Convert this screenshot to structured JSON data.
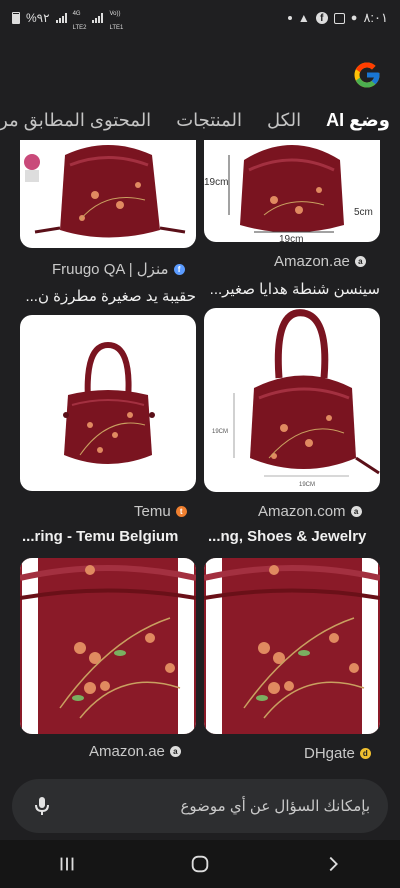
{
  "status_bar": {
    "battery": "%٩٢",
    "network_1": "4G",
    "network_1_sub": "LTE2",
    "network_2": "Vo))",
    "network_2_sub": "LTE1",
    "time": "٨:٠١"
  },
  "tabs": [
    {
      "label": "وضع AI",
      "active": true
    },
    {
      "label": "الكل",
      "active": false
    },
    {
      "label": "المنتجات",
      "active": false
    },
    {
      "label": "المحتوى المطابق مرئيًا",
      "active": false
    }
  ],
  "results": [
    {
      "source": "Amazon.ae",
      "caption": "سينسن شنطة هدايا صغير...",
      "favicon": "amazon-icon"
    },
    {
      "source": "Fruugo QA | منزل",
      "caption": "حقيبة يد صغيرة مطرزة ن...",
      "favicon": "fruugo-icon"
    },
    {
      "source": "Amazon.com",
      "caption": "...ng, Shoes & Jewelry",
      "favicon": "amazon-icon"
    },
    {
      "source": "Temu",
      "caption": "...ring - Temu Belgium",
      "favicon": "temu-icon"
    },
    {
      "source": "DHgate",
      "caption": "",
      "favicon": "dhgate-icon"
    },
    {
      "source": "Amazon.ae",
      "caption": "",
      "favicon": "amazon-icon"
    }
  ],
  "image_labels": {
    "height_1": "19cm",
    "width_1": "5cm",
    "bottom_1": "19cm",
    "height_2": "19CM",
    "bottom_2": "19CM"
  },
  "search": {
    "placeholder": "بإمكانك السؤال عن أي موضوع"
  },
  "colors": {
    "background": "#1f1f21",
    "bag": "#7a1420",
    "bag_light": "#9a2030",
    "flower": "#e08a60"
  },
  "nav": [
    "recent-apps-icon",
    "home-icon",
    "back-icon"
  ]
}
